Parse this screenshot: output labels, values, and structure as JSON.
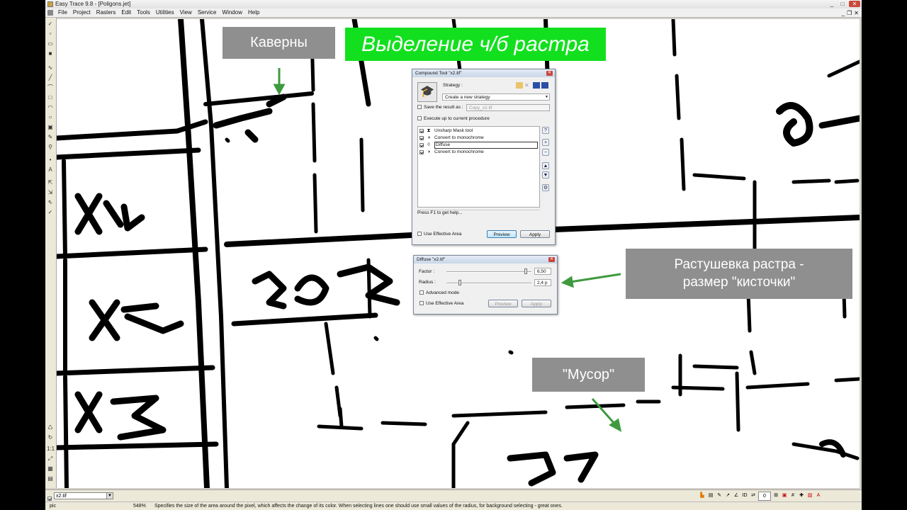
{
  "window": {
    "title": "Easy Trace 9.8 - [Poligons.jet]",
    "buttons": {
      "minimize": "_",
      "maximize": "□",
      "close": "✕"
    }
  },
  "menu": {
    "items": [
      "File",
      "Project",
      "Rasters",
      "Edit",
      "Tools",
      "Utilities",
      "View",
      "Service",
      "Window",
      "Help"
    ],
    "mdi_buttons": {
      "minimize": "_",
      "restore": "❐",
      "close": "✕"
    }
  },
  "overlays": {
    "caverns": "Каверны",
    "title": "Выделение ч/б растра",
    "feathering_line1": "Растушевка растра -",
    "feathering_line2": "размер \"кисточки\"",
    "garbage": "\"Мусор\"",
    "colors": {
      "gray": "#8f8f8f",
      "green": "#12e01e",
      "arrow": "#3e9a3e"
    }
  },
  "compound_dialog": {
    "title": "Compound Tool \"x2.tif\"",
    "strategy_label": "Strategy :",
    "strategy_value": "Create a new strategy",
    "save_label": "Save the result as :",
    "save_value": "Copy_x2.tif",
    "execute_label": "Execute up to current procedure",
    "procedures": [
      {
        "label": "Unsharp Mask tool",
        "icon": "unsharp-icon",
        "checked": true
      },
      {
        "label": "Convert to monochrome",
        "icon": "half-circle-icon",
        "checked": true
      },
      {
        "label": "Diffuse",
        "icon": "drop-icon",
        "checked": true,
        "selected": true
      },
      {
        "label": "Convert to monochrome",
        "icon": "half-circle-icon",
        "checked": true
      }
    ],
    "help_text": "Press F1 to get help...",
    "use_area_label": "Use Effective Area",
    "preview_label": "Preview",
    "apply_label": "Apply"
  },
  "diffuse_dialog": {
    "title": "Diffuse \"x2.tif\"",
    "factor_label": "Factor :",
    "factor_value": "6,50",
    "factor_level": 0.95,
    "radius_label": "Radius :",
    "radius_value": "2,4 p",
    "radius_level": 0.15,
    "advanced_label": "Advanced mode",
    "use_area_label": "Use Effective Area",
    "preview_label": "Preview",
    "apply_label": "Apply"
  },
  "bottom": {
    "layer_name": "x2.tif",
    "zoom_value": "0"
  },
  "status": {
    "units": "pic",
    "zoom": "548%",
    "message": "Specifies the size of the area around the pixel, which affects the change of its color. When selecting lines one should use small values of the radius, for background selecting - great ones."
  }
}
